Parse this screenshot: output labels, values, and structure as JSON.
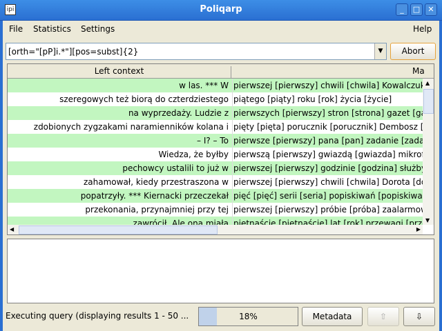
{
  "window": {
    "title": "Poliqarp",
    "app_icon": "ipi-icon"
  },
  "menu": {
    "file": "File",
    "statistics": "Statistics",
    "settings": "Settings",
    "help": "Help"
  },
  "query": {
    "value": "[orth=\"[pP]i.*\"][pos=subst]{2}",
    "abort_label": "Abort"
  },
  "table": {
    "columns": [
      "Left context",
      "Ma"
    ],
    "rows": [
      {
        "left": "w las. *** W",
        "match": "pierwszej [pierwszy] chwili [chwila] Kowalczuk ["
      },
      {
        "left": "szeregowych też biorą do czterdziestego",
        "match": "piątego [piąty] roku [rok] życia [życie]"
      },
      {
        "left": "na wyprzedaży. Ludzie z",
        "match": "pierwszych [pierwszy] stron [strona] gazet [gazeta]"
      },
      {
        "left": "zdobionych zygzakami naramienników kolana i",
        "match": "pięty [pięta] porucznik [porucznik] Dembosz ["
      },
      {
        "left": "– I? – To",
        "match": "pierwsze [pierwszy] pana [pan] zadanie [zadanie]"
      },
      {
        "left": "Wiedza, że byłby",
        "match": "pierwszą [pierwszy] gwiazdą [gwiazda] mikrofonu"
      },
      {
        "left": "pechowcy ustalili to już w",
        "match": "pierwszej [pierwszy] godzinie [godzina] służby"
      },
      {
        "left": "zahamował, kiedy przestraszona w",
        "match": "pierwszej [pierwszy] chwili [chwila] Dorota [dorota]"
      },
      {
        "left": "popatrzyły. *** Kiernacki przeczekał",
        "match": "pięć [pięć] serii [seria] popiskiwań [popiskiwanie]"
      },
      {
        "left": "przekonania, przynajmniej przy tej",
        "match": "pierwszej [pierwszy] próbie [próba] zaalarmow"
      },
      {
        "left": "zawrócił. Ale ona miała",
        "match": "piętnaście [piętnaście] lat [rok] przewagi [przewaga]"
      }
    ]
  },
  "status": {
    "text": "Executing query (displaying results 1 - 50 ...",
    "progress_percent": 18,
    "progress_label": "18%",
    "metadata_label": "Metadata"
  },
  "colors": {
    "row_highlight": "#c2f6c0",
    "titlebar": "#2a6fd2"
  }
}
